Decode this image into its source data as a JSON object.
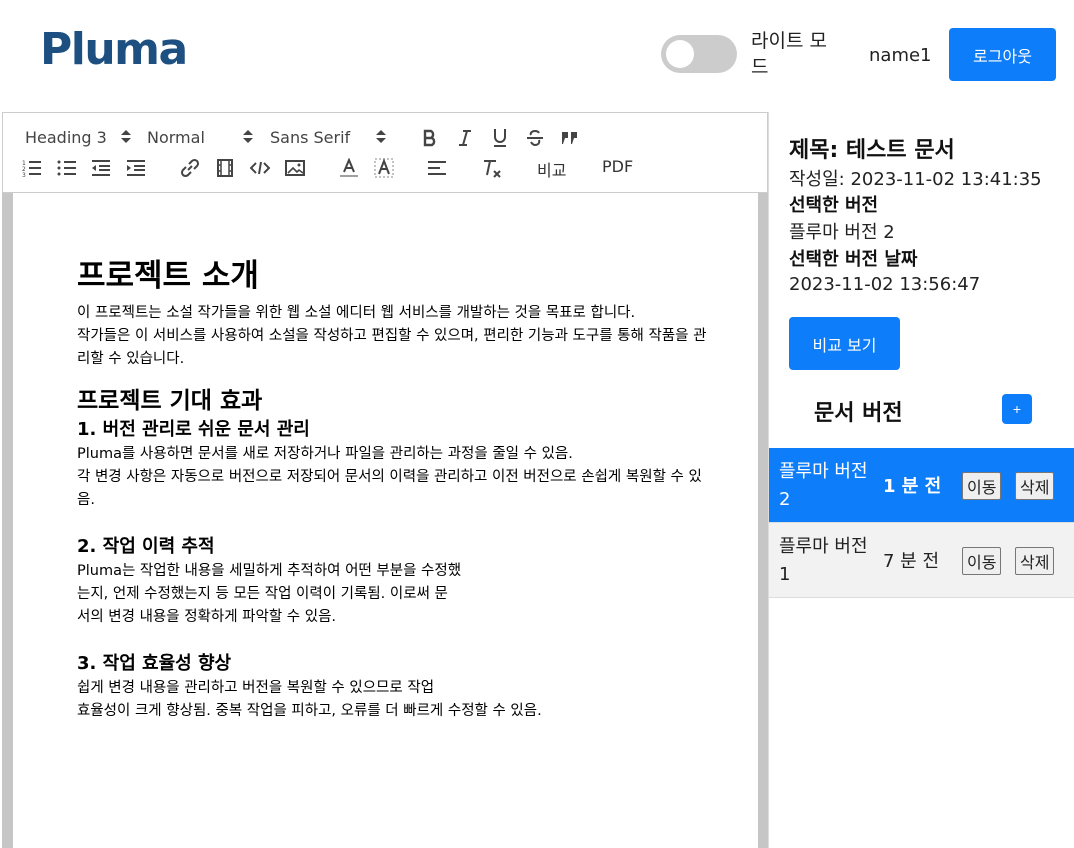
{
  "header": {
    "logo": "Pluma",
    "mode_label": "라이트 모드",
    "username": "name1",
    "logout_label": "로그아웃"
  },
  "toolbar": {
    "heading_select": "Heading 3",
    "size_select": "Normal",
    "font_select": "Sans Serif",
    "compare_label": "비교",
    "pdf_label": "PDF",
    "icons": [
      "bold-icon",
      "italic-icon",
      "underline-icon",
      "strike-icon",
      "blockquote-icon",
      "ordered-list-icon",
      "bullet-list-icon",
      "outdent-icon",
      "indent-icon",
      "link-icon",
      "video-icon",
      "code-icon",
      "image-icon",
      "font-color-icon",
      "background-color-icon",
      "align-icon",
      "clean-format-icon"
    ]
  },
  "document": {
    "h1": "프로젝트 소개",
    "intro_p1": "이 프로젝트는 소설 작가들을 위한 웹 소설 에디터 웹 서비스를 개발하는 것을 목표로 합니다.",
    "intro_p2": "작가들은 이 서비스를 사용하여 소설을 작성하고 편집할 수 있으며, 편리한 기능과 도구를 통해 작품을 관리할 수 있습니다.",
    "h2": "프로젝트 기대 효과",
    "sections": [
      {
        "title": "1. 버전 관리로 쉬운 문서 관리",
        "lines": [
          "Pluma를 사용하면 문서를 새로 저장하거나 파일을 관리하는 과정을 줄일 수 있음.",
          "각 변경 사항은 자동으로 버전으로 저장되어 문서의 이력을 관리하고 이전 버전으로 손쉽게 복원할 수 있음."
        ]
      },
      {
        "title": "2. 작업 이력 추적",
        "lines": [
          "Pluma는 작업한 내용을 세밀하게 추적하여 어떤 부분을 수정했",
          "는지, 언제 수정했는지 등 모든 작업 이력이 기록됨. 이로써 문",
          "서의 변경 내용을 정확하게 파악할 수 있음."
        ]
      },
      {
        "title": "3. 작업 효율성 향상",
        "lines": [
          "쉽게 변경 내용을 관리하고 버전을 복원할 수 있으므로 작업",
          "효율성이 크게 향상됨. 중복 작업을 피하고, 오류를 더 빠르게 수정할 수 있음."
        ]
      }
    ]
  },
  "side": {
    "title": "제목: 테스트 문서",
    "created": "작성일: 2023-11-02 13:41:35",
    "selected_version_label": "선택한 버전",
    "selected_version": "플루마 버전 2",
    "selected_date_label": "선택한 버전 날짜",
    "selected_date": "2023-11-02 13:56:47",
    "compare_button": "비교 보기",
    "versions_heading": "문서 버전",
    "add_button": "+",
    "versions": [
      {
        "name": "플루마 버전 2",
        "time": "1 분 전",
        "move": "이동",
        "delete": "삭제",
        "selected": true
      },
      {
        "name": "플루마 버전 1",
        "time": "7 분 전",
        "move": "이동",
        "delete": "삭제",
        "selected": false
      }
    ]
  },
  "colors": {
    "accent": "#0d7dfa",
    "logo": "#1d4f80",
    "toggle_off": "#cccccc",
    "editor_gutter": "#c6c6c6"
  }
}
